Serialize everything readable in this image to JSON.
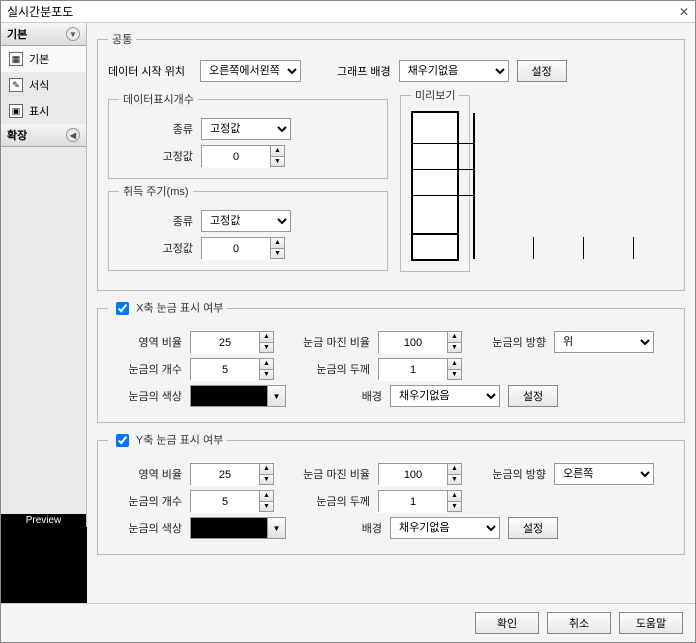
{
  "window": {
    "title": "실시간분포도",
    "close": "✕"
  },
  "sidebar": {
    "header_basic": "기본",
    "items": [
      {
        "label": "기본"
      },
      {
        "label": "서식"
      },
      {
        "label": "표시"
      }
    ],
    "header_ext": "확장",
    "preview_label": "Preview"
  },
  "common": {
    "legend": "공통",
    "data_start_label": "데이터 시작 위치",
    "data_start_value": "오른쪽에서왼쪽",
    "graph_bg_label": "그래프 배경",
    "graph_bg_value": "채우기없음",
    "settings_btn": "설정",
    "display_count": {
      "legend": "데이터표시개수",
      "type_label": "종류",
      "type_value": "고정값",
      "fixed_label": "고정값",
      "fixed_value": "0"
    },
    "acq_period": {
      "legend": "취득 주기(ms)",
      "type_label": "종류",
      "type_value": "고정값",
      "fixed_label": "고정값",
      "fixed_value": "0"
    },
    "preview_legend": "미리보기"
  },
  "xaxis": {
    "legend": "X축 눈금 표시 여부",
    "area_ratio_label": "영역 비율",
    "area_ratio_value": "25",
    "margin_label": "눈금 마진 비율",
    "margin_value": "100",
    "dir_label": "눈금의 방향",
    "dir_value": "위",
    "count_label": "눈금의 개수",
    "count_value": "5",
    "thick_label": "눈금의 두께",
    "thick_value": "1",
    "color_label": "눈금의 색상",
    "color_value": "#000000",
    "bg_label": "배경",
    "bg_value": "채우기없음",
    "settings_btn": "설정"
  },
  "yaxis": {
    "legend": "Y축 눈금 표시 여부",
    "area_ratio_label": "영역 비율",
    "area_ratio_value": "25",
    "margin_label": "눈금 마진 비율",
    "margin_value": "100",
    "dir_label": "눈금의 방향",
    "dir_value": "오른쪽",
    "count_label": "눈금의 개수",
    "count_value": "5",
    "thick_label": "눈금의 두께",
    "thick_value": "1",
    "color_label": "눈금의 색상",
    "color_value": "#000000",
    "bg_label": "배경",
    "bg_value": "채우기없음",
    "settings_btn": "설정"
  },
  "footer": {
    "ok": "확인",
    "cancel": "취소",
    "help": "도움말"
  }
}
